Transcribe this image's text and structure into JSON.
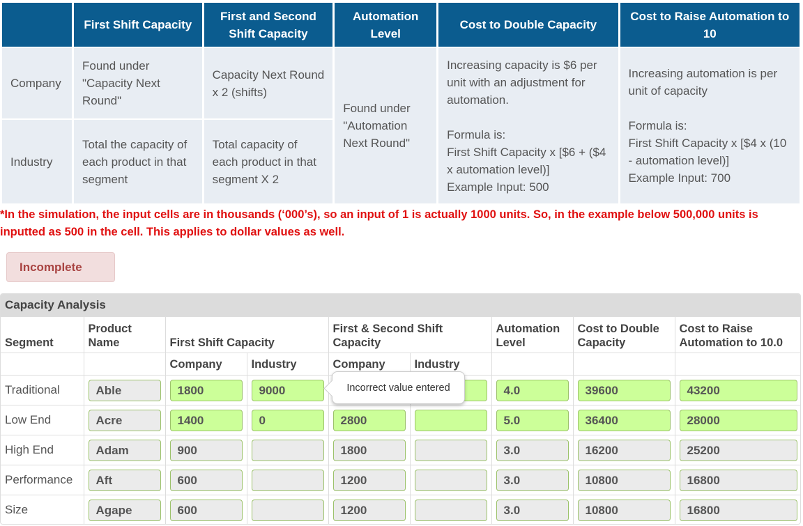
{
  "reference": {
    "headers": [
      "",
      "First Shift Capacity",
      "First and Second Shift Capacity",
      "Automation Level",
      "Cost to Double Capacity",
      "Cost to Raise Automation to 10"
    ],
    "company": {
      "label": "Company",
      "first_shift": "Found under \"Capacity Next Round\"",
      "first_second": "Capacity Next Round x 2 (shifts)"
    },
    "industry": {
      "label": "Industry",
      "first_shift": "Total the capacity of each product in that segment",
      "first_second": "Total capacity of each product in that segment X 2"
    },
    "automation": "Found under \"Automation Next Round\"",
    "cost_double": {
      "desc": "Increasing capacity is $6 per unit with an adjustment for automation.",
      "formula_label": "Formula is:",
      "formula": "First Shift Capacity x [$6 + ($4 x automation level)]",
      "example": "Example Input: 500"
    },
    "cost_raise": {
      "desc": "Increasing automation is per unit of capacity",
      "formula_label": "Formula is:",
      "formula": "First Shift Capacity x [$4 x (10 - automation level)]",
      "example": "Example Input: 700"
    }
  },
  "note": "*In the simulation, the input cells are in thousands (‘000’s), so an input of 1 is actually 1000 units. So, in the example below 500,000 units is inputted as 500 in the cell. This applies to dollar values as well.",
  "status": "Incomplete",
  "analysis": {
    "title": "Capacity Analysis",
    "headers": {
      "segment": "Segment",
      "product": "Product Name",
      "first_shift": "First Shift Capacity",
      "first_second": "First & Second Shift Capacity",
      "automation": "Automation Level",
      "cost_double": "Cost to Double Capacity",
      "cost_raise": "Cost to Raise Automation to 10.0",
      "company": "Company",
      "industry": "Industry"
    },
    "rows": [
      {
        "segment": "Traditional",
        "product": "Able",
        "fs_company": "1800",
        "fs_industry": "9000",
        "fss_company": "",
        "fss_industry": "",
        "automation": "4.0",
        "cost_double": "39600",
        "cost_raise": "43200"
      },
      {
        "segment": "Low End",
        "product": "Acre",
        "fs_company": "1400",
        "fs_industry": "0",
        "fss_company": "2800",
        "fss_industry": "",
        "automation": "5.0",
        "cost_double": "36400",
        "cost_raise": "28000"
      },
      {
        "segment": "High End",
        "product": "Adam",
        "fs_company": "900",
        "fs_industry": "",
        "fss_company": "1800",
        "fss_industry": "",
        "automation": "3.0",
        "cost_double": "16200",
        "cost_raise": "25200"
      },
      {
        "segment": "Performance",
        "product": "Aft",
        "fs_company": "600",
        "fs_industry": "",
        "fss_company": "1200",
        "fss_industry": "",
        "automation": "3.0",
        "cost_double": "10800",
        "cost_raise": "16800"
      },
      {
        "segment": "Size",
        "product": "Agape",
        "fs_company": "600",
        "fs_industry": "",
        "fss_company": "1200",
        "fss_industry": "",
        "automation": "3.0",
        "cost_double": "10800",
        "cost_raise": "16800"
      }
    ],
    "tooltip": "Incorrect value entered"
  },
  "colors": {
    "header_blue": "#0b5c8f",
    "note_red": "#e01010",
    "correct_green": "#ccff99",
    "incomplete_bg": "#f2dede"
  }
}
